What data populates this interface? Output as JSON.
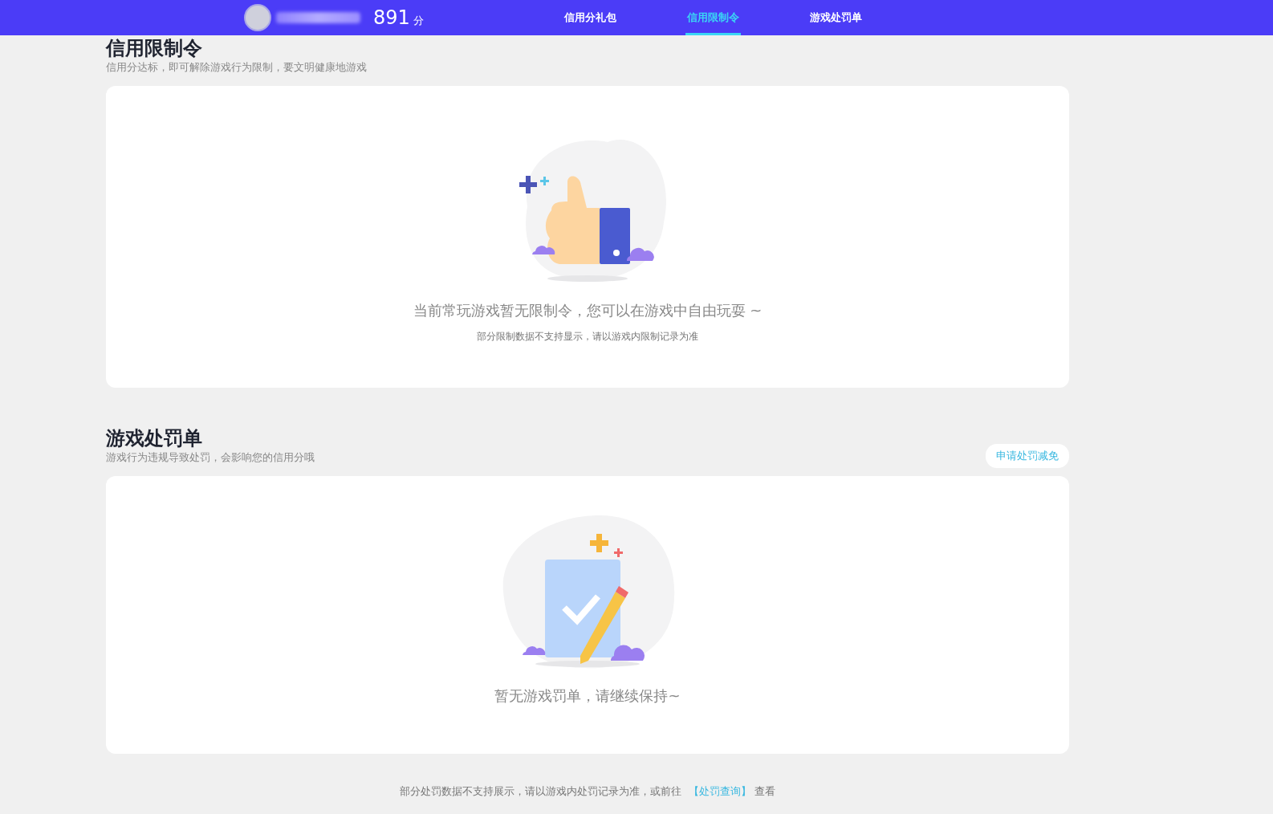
{
  "header": {
    "score": "891",
    "score_unit": "分",
    "tabs": [
      {
        "label": "信用分礼包",
        "selected": false
      },
      {
        "label": "信用限制令",
        "selected": true
      },
      {
        "label": "游戏处罚单",
        "selected": false
      }
    ]
  },
  "sections": [
    {
      "kind": "restriction",
      "title": "信用限制令",
      "subtitle": "信用分达标，即可解除游戏行为限制，要文明健康地游戏",
      "message": "当前常玩游戏暂无限制令，您可以在游戏中自由玩耍 ~",
      "note": "部分限制数据不支持显示，请以游戏内限制记录为准"
    },
    {
      "kind": "penalty",
      "title": "游戏处罚单",
      "subtitle": "游戏行为违规导致处罚，会影响您的信用分哦",
      "action": "申请处罚减免",
      "message": "暂无游戏罚单，请继续保持~"
    }
  ],
  "footer": {
    "text": "部分处罚数据不支持展示，请以游戏内处罚记录为准，或前往",
    "link": "【处罚查询】",
    "suffix": "查看"
  }
}
